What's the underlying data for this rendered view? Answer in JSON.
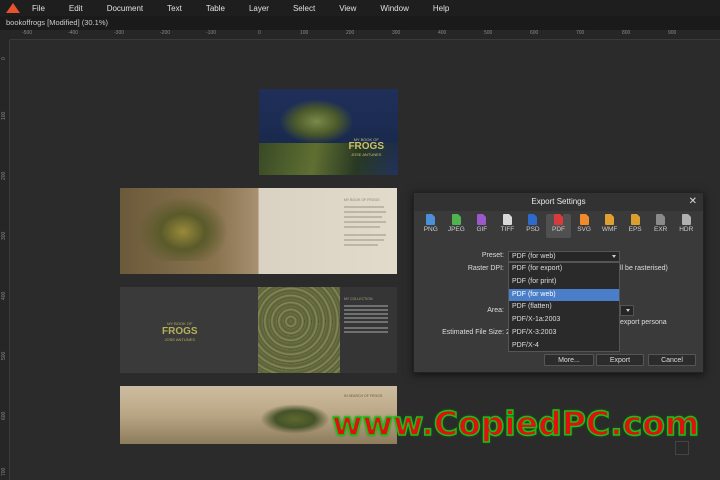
{
  "menubar": {
    "items": [
      "File",
      "Edit",
      "Document",
      "Text",
      "Table",
      "Layer",
      "Select",
      "View",
      "Window",
      "Help"
    ]
  },
  "document": {
    "tab_title": "bookoffrogs [Modified] (30.1%)"
  },
  "ruler_h": {
    "ticks": [
      "-500",
      "-400",
      "-300",
      "-200",
      "-100",
      "0",
      "100",
      "200",
      "300",
      "400",
      "500",
      "600",
      "700",
      "800",
      "900"
    ]
  },
  "ruler_v": {
    "ticks": [
      "0",
      "100",
      "200",
      "300",
      "400",
      "500",
      "600",
      "700"
    ]
  },
  "pages": {
    "cover_title_small": "MY BOOK OF",
    "cover_title_big": "FROGS",
    "cover_author": "JOSE ANTUNES",
    "spread1_heading": "MY BOOK OF FROGS",
    "spread2_title_small": "MY BOOK OF",
    "spread2_title_big": "FROGS",
    "spread2_author": "JOSE ANTUNES",
    "spread2_section": "MY COLLECTION",
    "spread3_heading": "IN SEARCH OF FROGS"
  },
  "export_dialog": {
    "title": "Export Settings",
    "formats": [
      {
        "label": "PNG",
        "color": "#4a90d9"
      },
      {
        "label": "JPEG",
        "color": "#4fb34f"
      },
      {
        "label": "GIF",
        "color": "#9a59c9"
      },
      {
        "label": "TIFF",
        "color": "#d9d9d9"
      },
      {
        "label": "PSD",
        "color": "#2d6ac9"
      },
      {
        "label": "PDF",
        "color": "#d93a3a"
      },
      {
        "label": "SVG",
        "color": "#f08a2a"
      },
      {
        "label": "WMF",
        "color": "#e0a030"
      },
      {
        "label": "EPS",
        "color": "#d9a030"
      },
      {
        "label": "EXR",
        "color": "#8a8a8a"
      },
      {
        "label": "HDR",
        "color": "#b0b0b0"
      }
    ],
    "active_format": "PDF",
    "preset_label": "Preset:",
    "preset_value": "PDF (for web)",
    "raster_dpi_label": "Raster DPI:",
    "raster_note": "ll be rasterised)",
    "area_label": "Area:",
    "export_persona": "export persona",
    "est_size_label": "Estimated File Size:",
    "est_size_value": "2",
    "preset_options": [
      "PDF (for export)",
      "PDF (for print)",
      "PDF (for web)",
      "PDF (flatten)",
      "PDF/X-1a:2003",
      "PDF/X-3:2003",
      "PDF/X-4"
    ],
    "selected_option": "PDF (for web)",
    "buttons": {
      "more": "More...",
      "export": "Export",
      "cancel": "Cancel"
    }
  },
  "watermark": {
    "text": "www.CopiedPC.com"
  }
}
